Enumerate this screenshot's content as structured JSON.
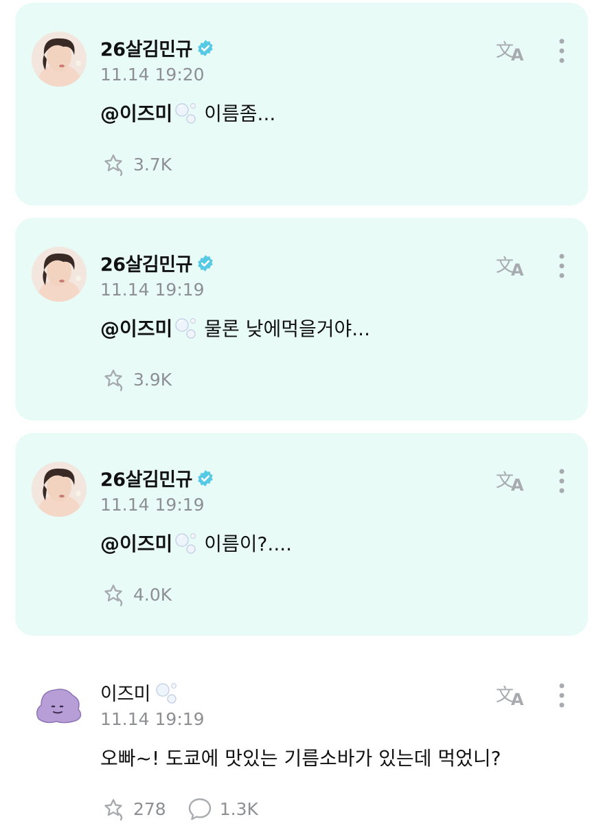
{
  "posts": [
    {
      "author": "26살김민규",
      "verified": true,
      "time": "11.14 19:20",
      "mention": "@이즈미",
      "body": "이름좀...",
      "reposts": "3.7K",
      "highlighted": true
    },
    {
      "author": "26살김민규",
      "verified": true,
      "time": "11.14 19:19",
      "mention": "@이즈미",
      "body": "물론 낮에먹을거야...",
      "reposts": "3.9K",
      "highlighted": true
    },
    {
      "author": "26살김민규",
      "verified": true,
      "time": "11.14 19:19",
      "mention": "@이즈미",
      "body": "이름이?....",
      "reposts": "4.0K",
      "highlighted": true
    },
    {
      "author": "이즈미",
      "verified": false,
      "time": "11.14 19:19",
      "mention": "",
      "body": "오빠~! 도쿄에 맛있는 기름소바가 있는데 먹었니?",
      "reposts": "278",
      "comments": "1.3K",
      "highlighted": false
    }
  ],
  "colors": {
    "card_bg": "#e8fbf7",
    "verified": "#57c9e4",
    "muted": "#8d8f93",
    "icon": "#a7aaae"
  },
  "icons": {
    "verified": "verified-badge-icon",
    "translate": "translate-icon",
    "more": "more-vertical-icon",
    "repost": "repost-icon",
    "comment": "comment-bubble-icon",
    "bubbles": "soap-bubbles-emoji"
  }
}
